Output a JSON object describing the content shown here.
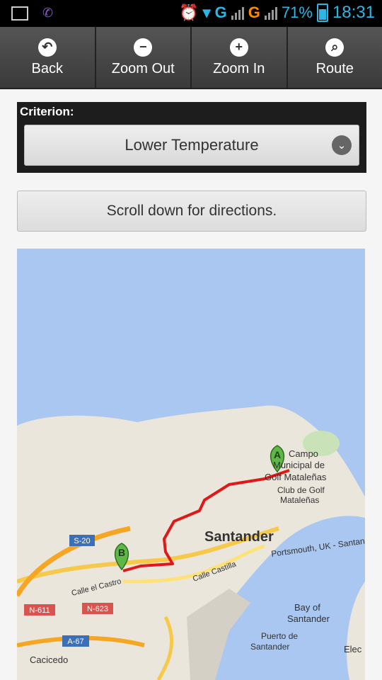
{
  "status_bar": {
    "battery": "71%",
    "time": "18:31",
    "net1": "G",
    "net2": "G"
  },
  "toolbar": {
    "back": "Back",
    "zoom_out": "Zoom Out",
    "zoom_in": "Zoom In",
    "route": "Route"
  },
  "criterion": {
    "label": "Criterion:",
    "selected": "Lower Temperature"
  },
  "directions_button": "Scroll down for directions.",
  "map": {
    "markers": {
      "a": "A",
      "b": "B"
    },
    "labels": {
      "campo1": "Campo",
      "campo2": "Municipal de",
      "campo3": "Golf Mataleñas",
      "club1": "Club de Golf",
      "club2": "Mataleñas",
      "city": "Santander",
      "portsmouth": "Portsmouth, UK - Santander",
      "calle_castilla": "Calle Castilla",
      "calle_castro": "Calle el Castro",
      "bay1": "Bay of",
      "bay2": "Santander",
      "puerto1": "Puerto de",
      "puerto2": "Santander",
      "cacicedo": "Cacicedo",
      "eleci": "Elec",
      "s20": "S-20",
      "n611": "N-611",
      "n623": "N-623",
      "a67": "A-67"
    },
    "colors": {
      "water": "#a9c7f0",
      "land": "#ebe6dc",
      "route": "#e01818",
      "marker": "#5db845"
    }
  }
}
